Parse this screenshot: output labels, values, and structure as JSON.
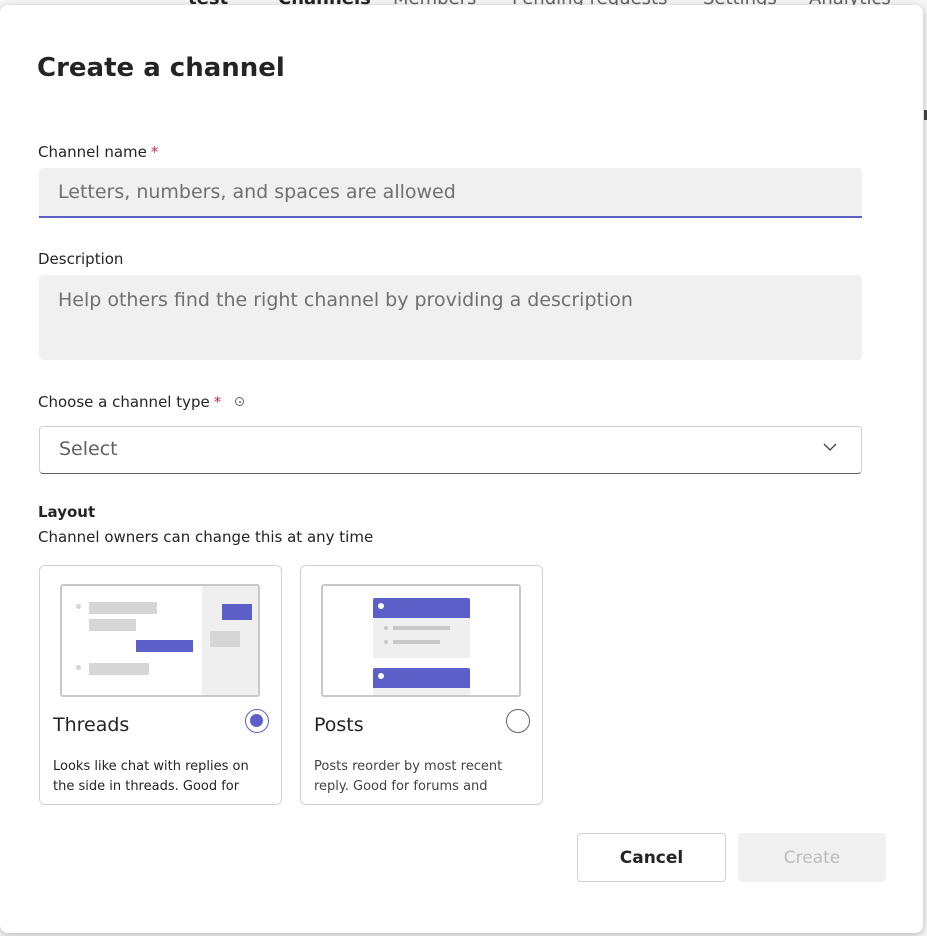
{
  "background": {
    "team_name": "test",
    "tabs": [
      "Channels",
      "Members",
      "Pending requests",
      "Settings",
      "Analytics"
    ]
  },
  "dialog": {
    "title": "Create a channel",
    "channel_name": {
      "label": "Channel name",
      "required_mark": "*",
      "value": "",
      "placeholder": "Letters, numbers, and spaces are allowed"
    },
    "description": {
      "label": "Description",
      "value": "",
      "placeholder": "Help others find the right channel by providing a description"
    },
    "channel_type": {
      "label": "Choose a channel type",
      "required_mark": "*",
      "selected": "Select"
    },
    "layout": {
      "title": "Layout",
      "subtitle": "Channel owners can change this at any time",
      "options": [
        {
          "name": "Threads",
          "description": "Looks like chat with replies on the side in threads. Good for",
          "selected": true
        },
        {
          "name": "Posts",
          "description": "Posts reorder by most recent reply. Good for forums and",
          "selected": false
        }
      ]
    },
    "buttons": {
      "cancel": "Cancel",
      "create": "Create"
    }
  },
  "colors": {
    "accent": "#5b5fc7",
    "required": "#c4314b",
    "placeholder_shape": "#d6d6d6"
  }
}
